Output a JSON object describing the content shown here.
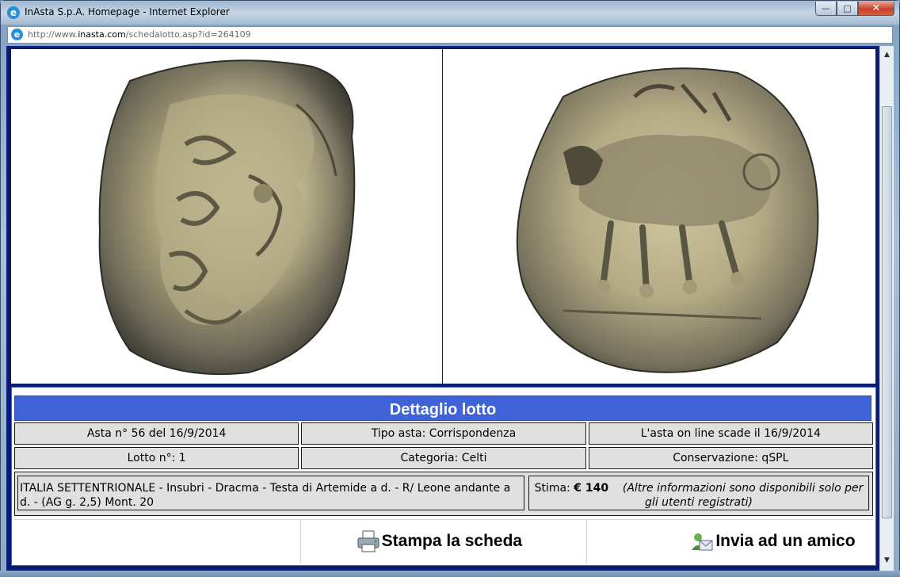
{
  "window": {
    "title": "InAsta S.p.A. Homepage - Internet Explorer",
    "url_prefix": "http://www.",
    "url_domain": "inasta.com",
    "url_path": "/schedalotto.asp?id=264109"
  },
  "detail": {
    "heading": "Dettaglio lotto",
    "row1": [
      "Asta n° 56 del 16/9/2014",
      "Tipo asta: Corrispondenza",
      "L'asta on line scade il 16/9/2014"
    ],
    "row2": [
      "Lotto n°: 1",
      "Categoria: Celti",
      "Conservazione: qSPL"
    ],
    "description": "ITALIA SETTENTRIONALE - Insubri - Dracma - Testa di Artemide a d. - R/ Leone andante a d. - (AG g. 2,5) Mont. 20",
    "stima_label": "Stima:",
    "stima_value": "€ 140",
    "stima_note": "(Altre informazioni sono disponibili solo per gli utenti registrati)"
  },
  "actions": {
    "print_label": "Stampa la scheda",
    "send_label": "Invia ad un amico"
  },
  "colors": {
    "header_blue": "#3f63d6",
    "frame_navy": "#0a1a6e",
    "cell_gray": "#e0e0e0"
  },
  "icons": {
    "browser": "internet-explorer-icon",
    "print": "printer-icon",
    "send": "send-mail-icon"
  }
}
